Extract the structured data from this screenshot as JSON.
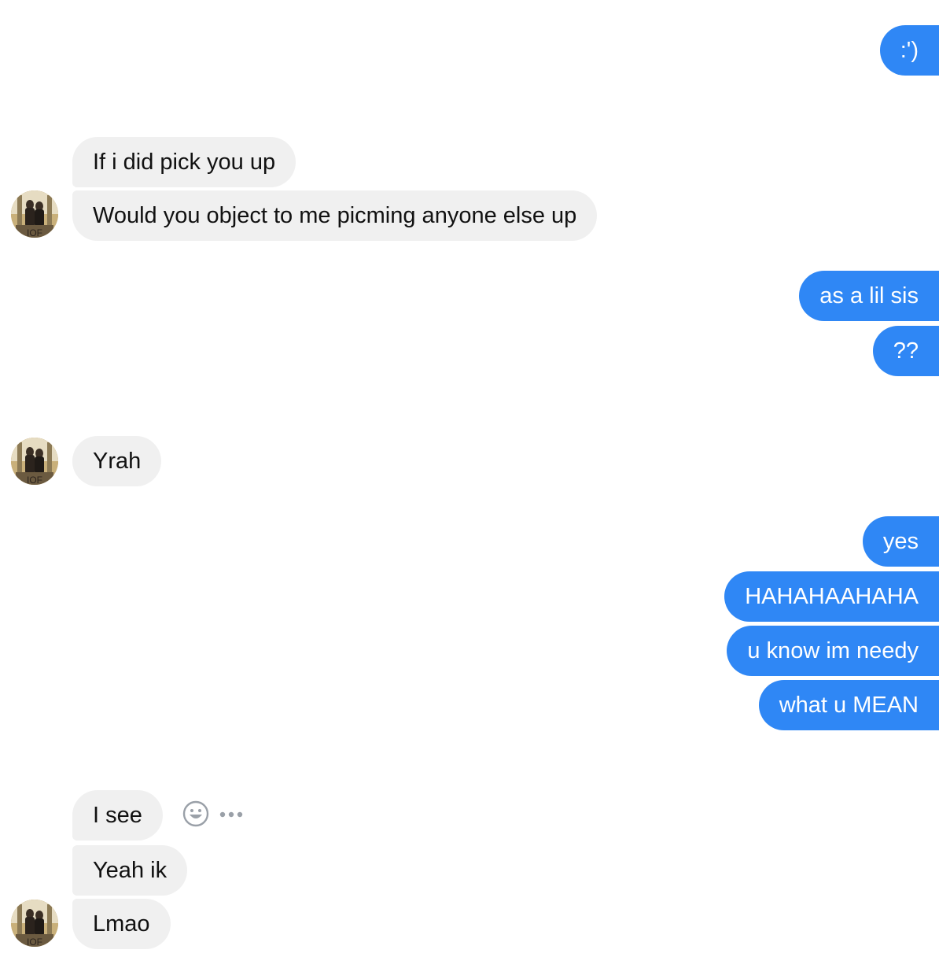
{
  "conversation": {
    "messages": [
      {
        "id": "m1",
        "side": "out",
        "text": ":')"
      },
      {
        "id": "m2",
        "side": "in",
        "text": "If i did pick you up"
      },
      {
        "id": "m3",
        "side": "in",
        "text": "Would you object to me picming anyone else up"
      },
      {
        "id": "m4",
        "side": "out",
        "text": "as a lil sis"
      },
      {
        "id": "m5",
        "side": "out",
        "text": "??"
      },
      {
        "id": "m6",
        "side": "in",
        "text": "Yrah"
      },
      {
        "id": "m7",
        "side": "out",
        "text": "yes"
      },
      {
        "id": "m8",
        "side": "out",
        "text": "HAHAHAAHAHA"
      },
      {
        "id": "m9",
        "side": "out",
        "text": "u know im needy"
      },
      {
        "id": "m10",
        "side": "out",
        "text": "what u MEAN"
      },
      {
        "id": "m11",
        "side": "in",
        "text": "I see"
      },
      {
        "id": "m12",
        "side": "in",
        "text": "Yeah ik"
      },
      {
        "id": "m13",
        "side": "in",
        "text": "Lmao"
      }
    ]
  },
  "message_actions": {
    "icons": [
      "emoji-reaction-icon",
      "more-options-icon"
    ]
  },
  "colors": {
    "outgoing_bubble": "#2f87f5",
    "incoming_bubble": "#f0f0f0",
    "icon_gray": "#9aa0a8"
  }
}
